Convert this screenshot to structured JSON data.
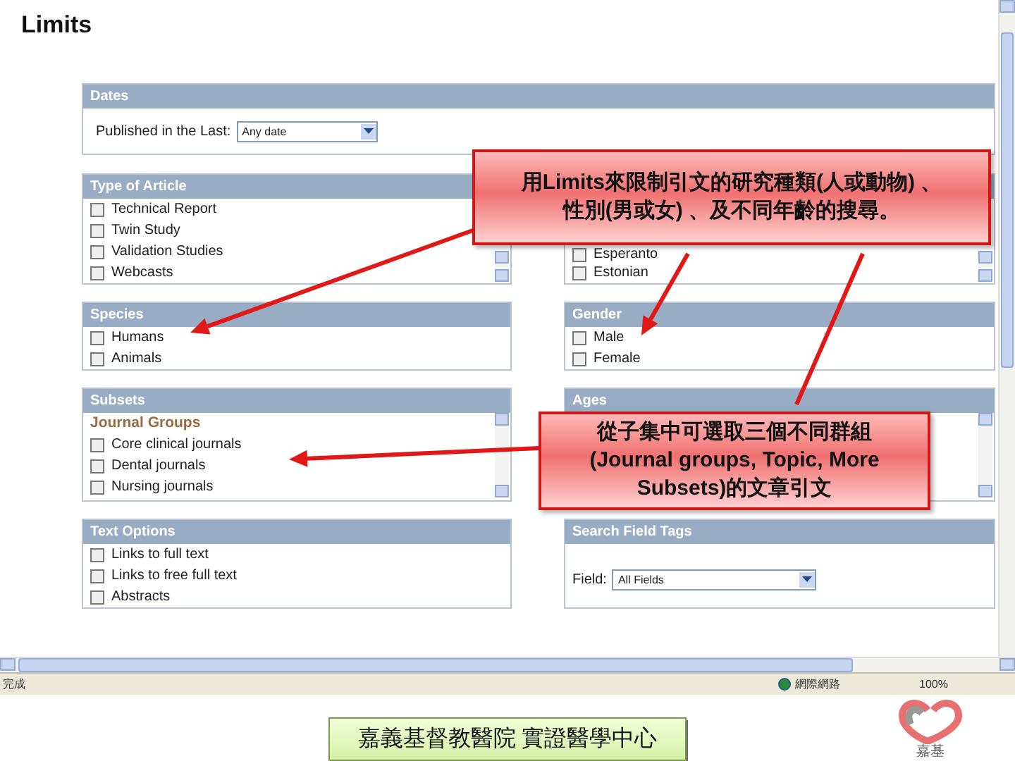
{
  "page_title": "Limits",
  "dates": {
    "title": "Dates",
    "label": "Published in the Last:",
    "value": "Any date"
  },
  "rows": [
    [
      {
        "kind": "checklist",
        "title": "Type of Article",
        "scrollable": true,
        "items": [
          {
            "label": "Technical Report",
            "checked": false
          },
          {
            "label": "Twin Study",
            "checked": false
          },
          {
            "label": "Validation Studies",
            "checked": false
          },
          {
            "label": "Webcasts",
            "checked": false
          }
        ]
      },
      {
        "kind": "checklist",
        "scrollable": true,
        "items": [
          {
            "label": "Esperanto",
            "checked": false
          },
          {
            "label": "Estonian",
            "checked": false
          }
        ]
      }
    ],
    [
      {
        "kind": "checklist",
        "title": "Species",
        "scrollable": false,
        "items": [
          {
            "label": "Humans",
            "checked": false
          },
          {
            "label": "Animals",
            "checked": false
          }
        ]
      },
      {
        "kind": "checklist",
        "title": "Gender",
        "scrollable": false,
        "items": [
          {
            "label": "Male",
            "checked": false
          },
          {
            "label": "Female",
            "checked": false
          }
        ]
      }
    ],
    [
      {
        "kind": "checklist",
        "title": "Subsets",
        "subheading": "Journal Groups",
        "scrollable": true,
        "items": [
          {
            "label": "Core clinical journals",
            "checked": false
          },
          {
            "label": "Dental journals",
            "checked": false
          },
          {
            "label": "Nursing journals",
            "checked": false
          }
        ]
      },
      {
        "kind": "checklist",
        "title": "Ages",
        "scrollable": true
      }
    ],
    [
      {
        "kind": "checklist",
        "title": "Text Options",
        "scrollable": false,
        "items": [
          {
            "label": "Links to full text",
            "checked": false
          },
          {
            "label": "Links to free full text",
            "checked": false
          },
          {
            "label": "Abstracts",
            "checked": false
          }
        ]
      },
      {
        "kind": "select",
        "title": "Search Field Tags",
        "label": "Field:",
        "value": "All Fields"
      }
    ]
  ],
  "callouts": [
    {
      "lines": [
        "用Limits來限制引文的研究種類(人或動物) 、",
        "性別(男或女) 、及不同年齡的搜尋。"
      ]
    },
    {
      "lines": [
        "從子集中可選取三個不同群組",
        "(Journal groups, Topic, More",
        "Subsets)的文章引文"
      ]
    }
  ],
  "status_bar": {
    "text": "完成",
    "zone": "網際網路",
    "zoom": "100%"
  },
  "footer": {
    "caption": "嘉義基督教醫院 實證醫學中心",
    "logo_text": "嘉基"
  }
}
